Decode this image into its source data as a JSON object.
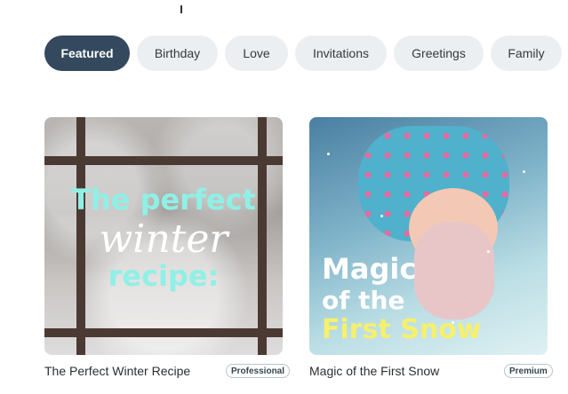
{
  "categories": [
    {
      "label": "Featured",
      "active": true
    },
    {
      "label": "Birthday",
      "active": false
    },
    {
      "label": "Love",
      "active": false
    },
    {
      "label": "Invitations",
      "active": false
    },
    {
      "label": "Greetings",
      "active": false
    },
    {
      "label": "Family",
      "active": false
    }
  ],
  "cards": [
    {
      "title": "The Perfect Winter Recipe",
      "badge": "Professional",
      "image_text": [
        "The perfect",
        "winter",
        "recipe:"
      ]
    },
    {
      "title": "Magic of the First Snow",
      "badge": "Premium",
      "image_text": [
        "Magic",
        "of the",
        "First Snow"
      ]
    }
  ],
  "colors": {
    "active_chip": "#34495e",
    "chip": "#eceff1"
  }
}
